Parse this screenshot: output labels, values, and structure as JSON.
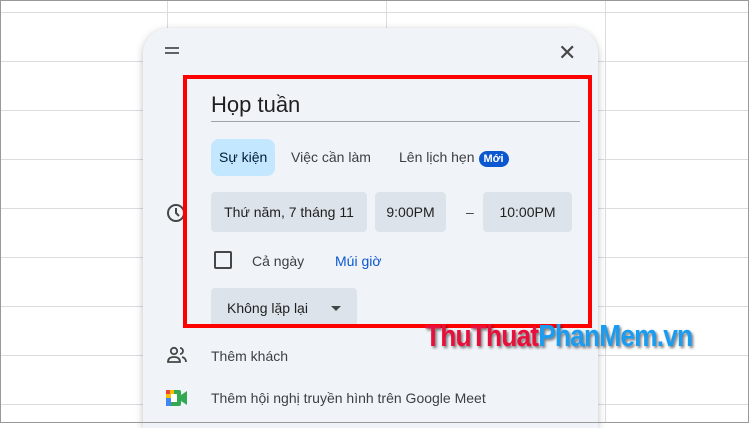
{
  "dialog": {
    "title": "Họp tuần",
    "tabs": [
      {
        "label": "Sự kiện",
        "selected": true
      },
      {
        "label": "Việc cần làm"
      },
      {
        "label": "Lên lịch hẹn",
        "badge": "Mới"
      }
    ],
    "date": "Thứ năm, 7 tháng 11",
    "start_time": "9:00PM",
    "separator": "–",
    "end_time": "10:00PM",
    "all_day_label": "Cả ngày",
    "all_day_checked": false,
    "timezone_link": "Múi giờ",
    "repeat": "Không lặp lại",
    "add_guests": "Thêm khách",
    "add_meet": "Thêm hội nghị truyền hình trên Google Meet"
  },
  "watermark": {
    "part1": "ThuThuat",
    "part2": "PhanMem",
    "part3": ".vn"
  },
  "colors": {
    "highlight": "#ff0000",
    "accent": "#0b57d0",
    "selected_tab": "#c2e7ff"
  }
}
